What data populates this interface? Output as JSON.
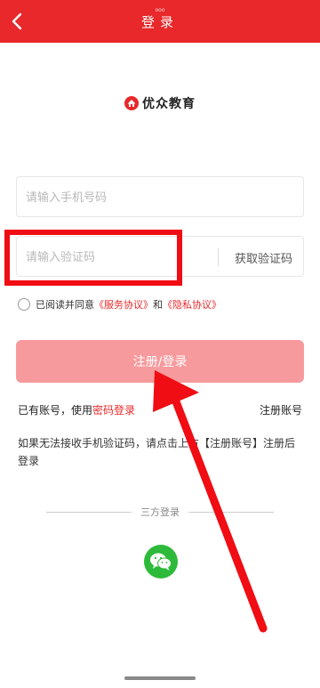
{
  "header": {
    "title": "登录",
    "subtitle": "ooo",
    "bg_color": "#e8282b"
  },
  "logo": {
    "text": "优众教育",
    "icon": "house-logo-icon"
  },
  "phone_field": {
    "placeholder": "请输入手机号码"
  },
  "code_field": {
    "placeholder": "请输入验证码",
    "get_code_label": "获取验证码"
  },
  "agreement": {
    "prefix": "已阅读并同意",
    "service": "《服务协议》",
    "and": "和",
    "privacy": "《隐私协议》"
  },
  "submit_label": "注册/登录",
  "account": {
    "have_account": "已有账号，使用",
    "password_login": "密码登录",
    "register": "注册账号"
  },
  "tip": "如果无法接收手机验证码，请点击上方【注册账号】注册后登录",
  "third_party": {
    "label": "三方登录",
    "icon": "wechat-icon"
  },
  "colors": {
    "accent": "#e8282b",
    "button": "#f79a9d",
    "annotation": "#f00d14",
    "wechat": "#2dba3a"
  }
}
